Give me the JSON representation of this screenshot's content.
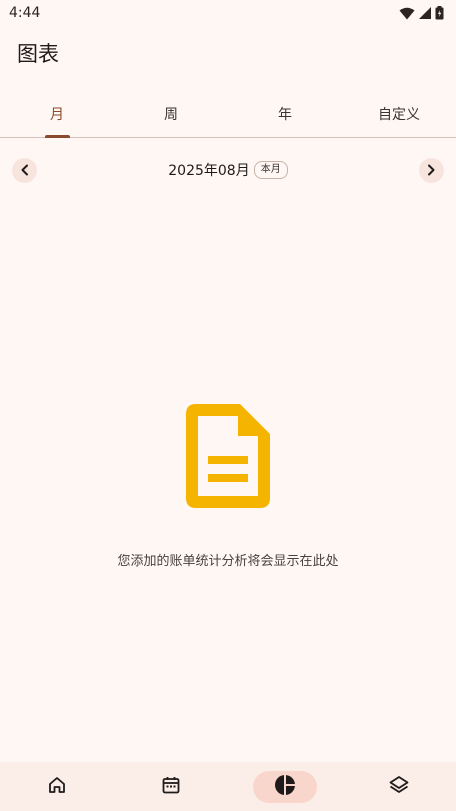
{
  "status_bar": {
    "time": "4:44",
    "icons": [
      "wifi-icon",
      "signal-icon",
      "battery-icon"
    ]
  },
  "app_bar": {
    "title": "图表"
  },
  "tabs": [
    {
      "label": "月",
      "active": true
    },
    {
      "label": "周",
      "active": false
    },
    {
      "label": "年",
      "active": false
    },
    {
      "label": "自定义",
      "active": false
    }
  ],
  "date_nav": {
    "label": "2025年08月",
    "badge": "本月",
    "prev_icon": "chevron-left-icon",
    "next_icon": "chevron-right-icon"
  },
  "empty_state": {
    "icon": "document-icon",
    "message": "您添加的账单统计分析将会显示在此处"
  },
  "bottom_nav": {
    "items": [
      {
        "icon": "home-icon",
        "active": false
      },
      {
        "icon": "calendar-icon",
        "active": false
      },
      {
        "icon": "pie-chart-icon",
        "active": true
      },
      {
        "icon": "layers-icon",
        "active": false
      }
    ]
  },
  "colors": {
    "background": "#FFF7F4",
    "accent": "#8B4A2C",
    "empty_icon": "#F4B400",
    "active_nav_pill": "#F9D6CB"
  }
}
